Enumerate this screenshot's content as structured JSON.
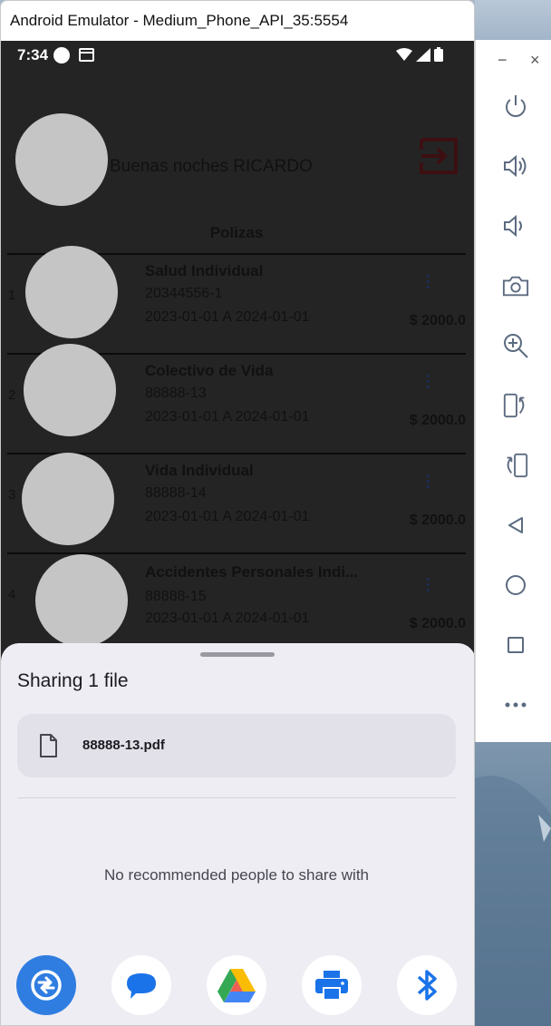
{
  "window": {
    "title": "Android Emulator - Medium_Phone_API_35:5554"
  },
  "statusbar": {
    "time": "7:34"
  },
  "app": {
    "greeting": "Buenas noches  RICARDO",
    "section_title": "Polizas",
    "policies": [
      {
        "index": "1",
        "name": "Salud Individual",
        "number": "20344556-1",
        "dates": "2023-01-01 A 2024-01-01",
        "amount": "$ 2000.0"
      },
      {
        "index": "2",
        "name": "Colectivo de Vida",
        "number": "88888-13",
        "dates": "2023-01-01 A 2024-01-01",
        "amount": "$ 2000.0"
      },
      {
        "index": "3",
        "name": "Vida Individual",
        "number": "88888-14",
        "dates": "2023-01-01 A 2024-01-01",
        "amount": "$ 2000.0"
      },
      {
        "index": "4",
        "name": "Accidentes Personales Indi...",
        "number": "88888-15",
        "dates": "2023-01-01 A 2024-01-01",
        "amount": "$ 2000.0"
      }
    ]
  },
  "share_sheet": {
    "title": "Sharing 1 file",
    "file_name": "88888-13.pdf",
    "empty_message": "No recommended people to share with",
    "targets": [
      {
        "icon": "nearby-share-icon",
        "color": "#2f7de1"
      },
      {
        "icon": "messages-icon",
        "color": "#1a73e8"
      },
      {
        "icon": "google-drive-icon",
        "color": "#34a853"
      },
      {
        "icon": "print-icon",
        "color": "#1a73e8"
      },
      {
        "icon": "bluetooth-icon",
        "color": "#1a73e8"
      }
    ]
  },
  "toolbar": {
    "buttons": [
      "power-icon",
      "volume-up-icon",
      "volume-down-icon",
      "camera-icon",
      "zoom-icon",
      "rotate-left-icon",
      "rotate-right-icon",
      "back-icon",
      "home-icon",
      "overview-icon",
      "more-icon"
    ]
  }
}
